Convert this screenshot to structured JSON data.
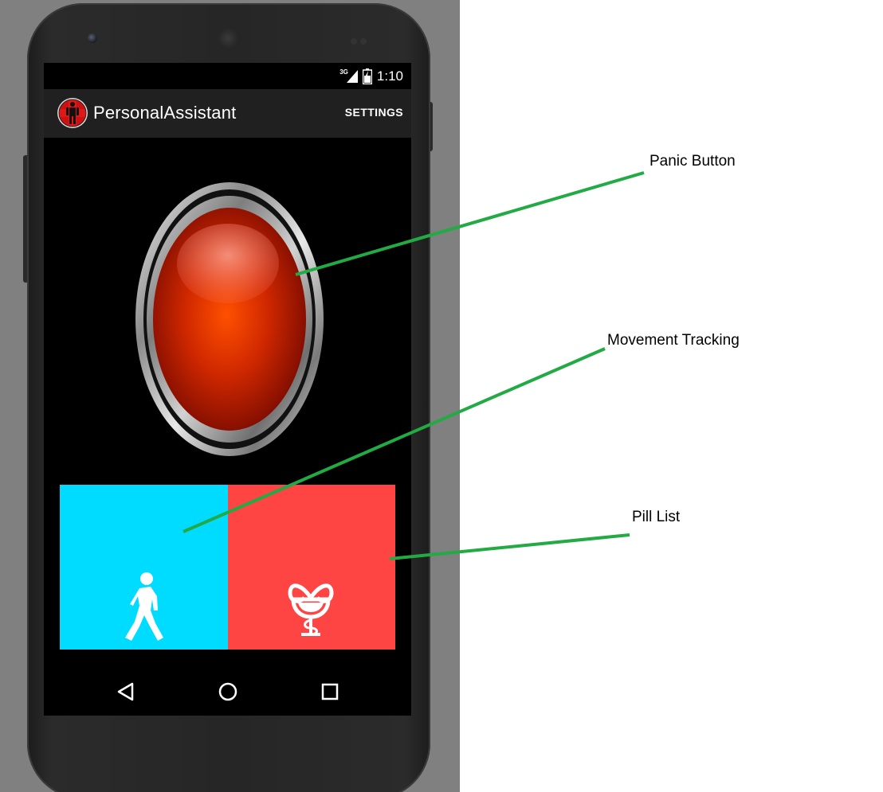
{
  "device": {
    "status_bar": {
      "network_label": "3G",
      "time": "1:10",
      "icons": [
        "signal-icon",
        "battery-icon"
      ]
    },
    "action_bar": {
      "app_icon": "medical-cross-person-icon",
      "title": "PersonalAssistant",
      "settings_label": "SETTINGS"
    },
    "panic_button": {
      "icon": "red-panic-button",
      "color": "#ff4400"
    },
    "tiles": [
      {
        "name": "movement-tracking",
        "icon": "walking-person-icon",
        "color": "#00dcff"
      },
      {
        "name": "pill-list",
        "icon": "pharmacy-bowl-icon",
        "color": "#ff4444"
      }
    ],
    "nav_bar": {
      "icons": [
        "back-icon",
        "home-icon",
        "recents-icon"
      ]
    }
  },
  "annotations": {
    "panic": "Panic Button",
    "movement": "Movement Tracking",
    "pill": "Pill List",
    "line_color": "#22aa44"
  }
}
